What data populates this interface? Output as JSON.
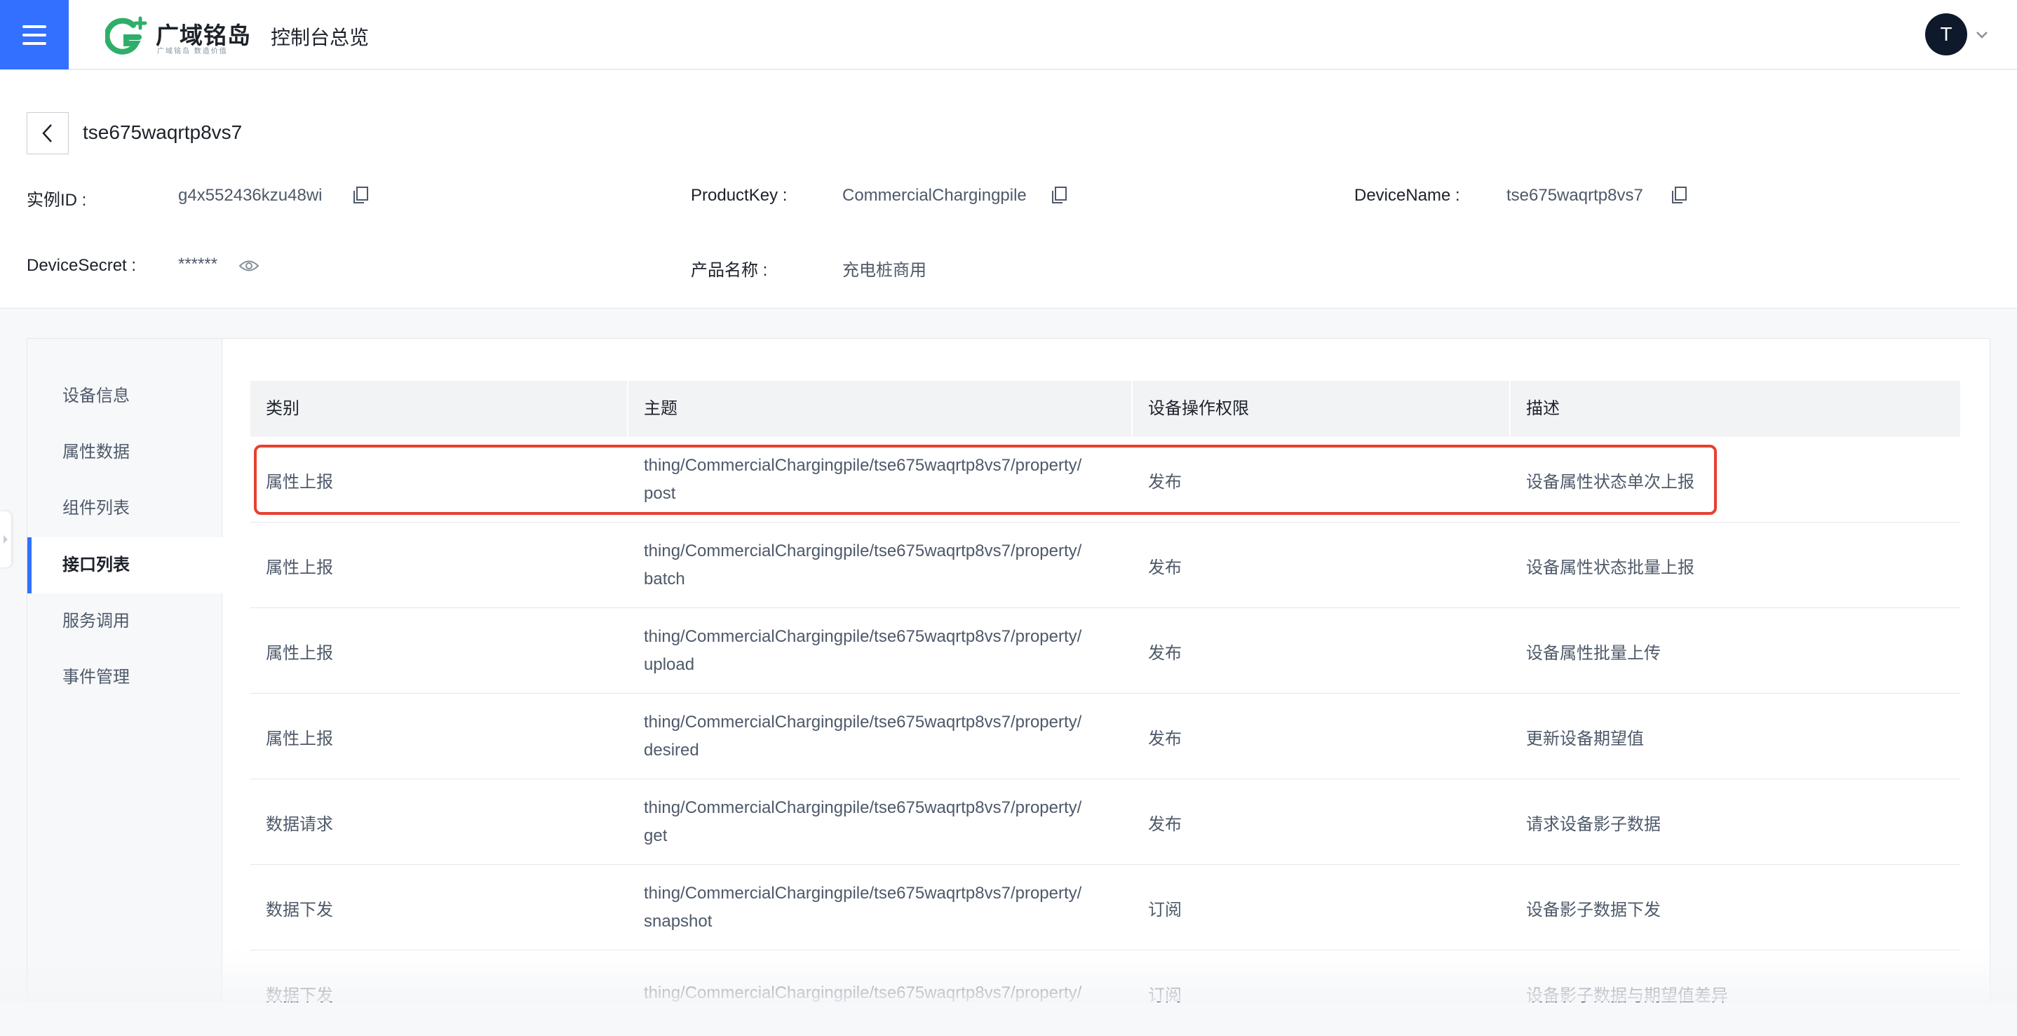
{
  "header": {
    "logo_name": "广域铭岛",
    "logo_slogan": "广域铭岛 数造价值",
    "console_title": "控制台总览",
    "avatar_initial": "T",
    "brand_color": "#3370ff"
  },
  "device": {
    "title": "tse675waqrtp8vs7",
    "fields": {
      "instance_id_label": "实例ID :",
      "instance_id_value": "g4x552436kzu48wi",
      "product_key_label": "ProductKey :",
      "product_key_value": "CommercialChargingpile",
      "device_name_label": "DeviceName :",
      "device_name_value": "tse675waqrtp8vs7",
      "device_secret_label": "DeviceSecret :",
      "device_secret_value": "******",
      "product_name_label": "产品名称 :",
      "product_name_value": "充电桩商用"
    }
  },
  "sidebar": {
    "items": [
      {
        "label": "设备信息"
      },
      {
        "label": "属性数据"
      },
      {
        "label": "组件列表"
      },
      {
        "label": "接口列表",
        "active": true
      },
      {
        "label": "服务调用"
      },
      {
        "label": "事件管理"
      }
    ]
  },
  "table": {
    "columns": [
      "类别",
      "主题",
      "设备操作权限",
      "描述"
    ],
    "rows": [
      {
        "category": "属性上报",
        "topic_line1": "thing/CommercialChargingpile/tse675waqrtp8vs7/property/",
        "topic_line2": "post",
        "permission": "发布",
        "description": "设备属性状态单次上报"
      },
      {
        "category": "属性上报",
        "topic_line1": "thing/CommercialChargingpile/tse675waqrtp8vs7/property/",
        "topic_line2": "batch",
        "permission": "发布",
        "description": "设备属性状态批量上报"
      },
      {
        "category": "属性上报",
        "topic_line1": "thing/CommercialChargingpile/tse675waqrtp8vs7/property/",
        "topic_line2": "upload",
        "permission": "发布",
        "description": "设备属性批量上传"
      },
      {
        "category": "属性上报",
        "topic_line1": "thing/CommercialChargingpile/tse675waqrtp8vs7/property/",
        "topic_line2": "desired",
        "permission": "发布",
        "description": "更新设备期望值"
      },
      {
        "category": "数据请求",
        "topic_line1": "thing/CommercialChargingpile/tse675waqrtp8vs7/property/",
        "topic_line2": "get",
        "permission": "发布",
        "description": "请求设备影子数据"
      },
      {
        "category": "数据下发",
        "topic_line1": "thing/CommercialChargingpile/tse675waqrtp8vs7/property/",
        "topic_line2": "snapshot",
        "permission": "订阅",
        "description": "设备影子数据下发"
      },
      {
        "category": "数据下发",
        "topic_line1": "thing/CommercialChargingpile/tse675waqrtp8vs7/property/",
        "topic_line2": "",
        "permission": "订阅",
        "description": "设备影子数据与期望值差异"
      }
    ]
  },
  "highlight_color": "#e8402e"
}
